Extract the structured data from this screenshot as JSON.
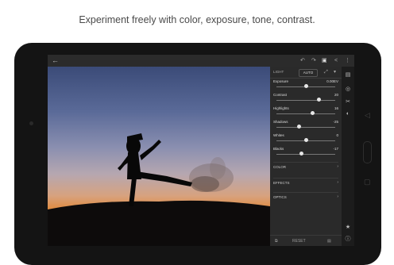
{
  "caption": "Experiment freely with color, exposure, tone, contrast.",
  "topbar": {
    "back_icon": "←",
    "icons": [
      "↶",
      "↷",
      "▣",
      "<",
      "⋮"
    ]
  },
  "panel": {
    "header": {
      "left": "LIGHT",
      "auto": "AUTO",
      "icons": [
        "⤢",
        "▾"
      ]
    },
    "sliders": [
      {
        "label": "Exposure",
        "value": "0.00EV",
        "position": 0.5
      },
      {
        "label": "Contrast",
        "value": "20",
        "position": 0.72
      },
      {
        "label": "Highlights",
        "value": "16",
        "position": 0.62
      },
      {
        "label": "Shadows",
        "value": "-25",
        "position": 0.38
      },
      {
        "label": "Whites",
        "value": "0",
        "position": 0.5
      },
      {
        "label": "Blacks",
        "value": "-17",
        "position": 0.42
      }
    ],
    "sections": [
      {
        "label": "COLOR",
        "chev": "›"
      },
      {
        "label": "EFFECTS",
        "chev": "›"
      },
      {
        "label": "OPTICS",
        "chev": "›"
      }
    ],
    "footer": {
      "left_icon": "⧉",
      "reset": "RESET",
      "right_icon": "▤"
    }
  },
  "rail": {
    "icons": [
      "▤",
      "◎",
      "✂",
      "◐",
      "★",
      "ⓘ"
    ]
  },
  "system_buttons": {
    "back": "◁",
    "recents": "▢"
  },
  "colors": {
    "panel_bg": "#2a2a2a",
    "screen_bg": "#232323",
    "bezel": "#141414"
  }
}
